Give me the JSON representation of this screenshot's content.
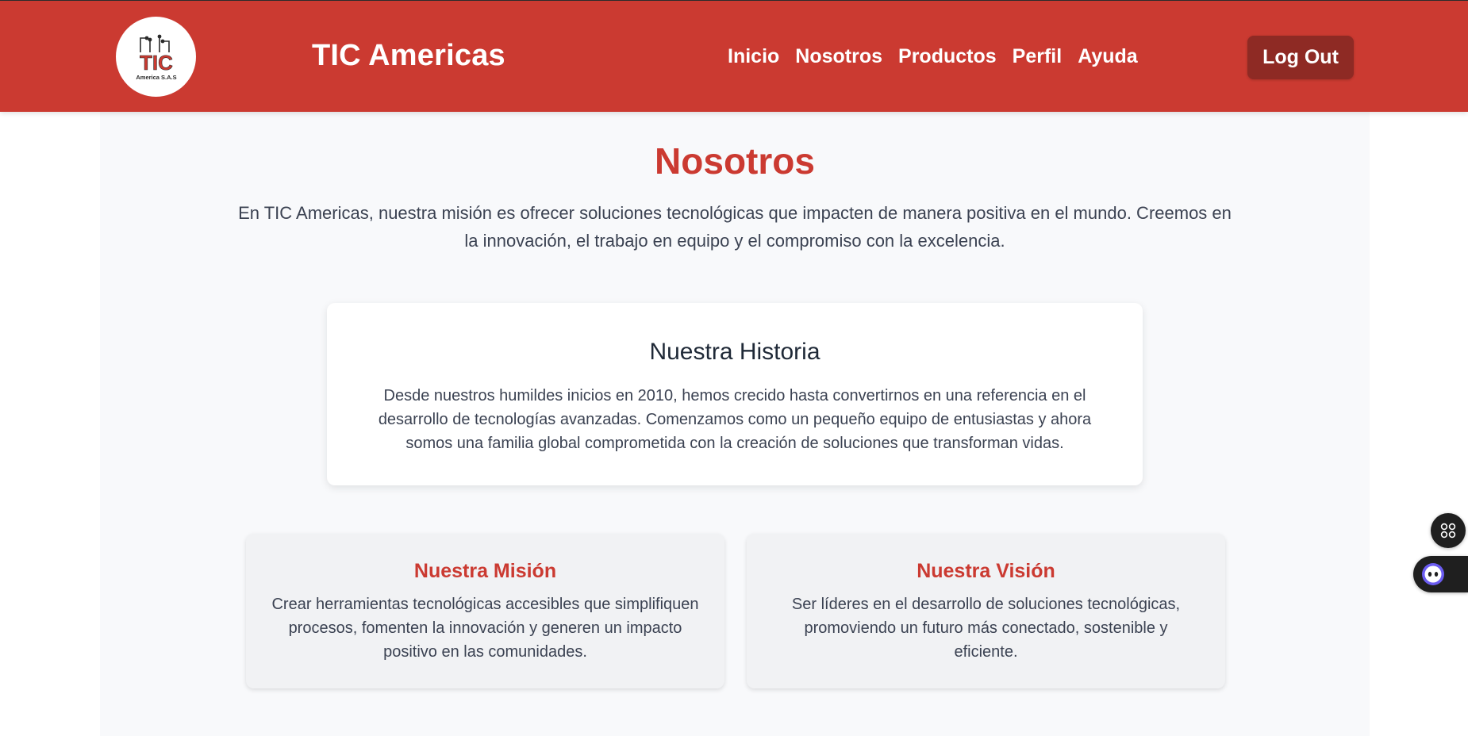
{
  "header": {
    "logo_text": "TIC",
    "logo_subtext": "America S.A.S",
    "brand": "TIC Americas",
    "nav": [
      {
        "label": "Inicio"
      },
      {
        "label": "Nosotros"
      },
      {
        "label": "Productos"
      },
      {
        "label": "Perfil"
      },
      {
        "label": "Ayuda"
      }
    ],
    "logout_label": "Log Out"
  },
  "main": {
    "title": "Nosotros",
    "intro": "En TIC Americas, nuestra misión es ofrecer soluciones tecnológicas que impacten de manera positiva en el mundo. Creemos en la innovación, el trabajo en equipo y el compromiso con la excelencia.",
    "history": {
      "title": "Nuestra Historia",
      "text": "Desde nuestros humildes inicios en 2010, hemos crecido hasta convertirnos en una referencia en el desarrollo de tecnologías avanzadas. Comenzamos como un pequeño equipo de entusiastas y ahora somos una familia global comprometida con la creación de soluciones que transforman vidas."
    },
    "mision": {
      "title": "Nuestra Misión",
      "text": "Crear herramientas tecnológicas accesibles que simplifiquen procesos, fomenten la innovación y generen un impacto positivo en las comunidades."
    },
    "vision": {
      "title": "Nuestra Visión",
      "text": "Ser líderes en el desarrollo de soluciones tecnológicas, promoviendo un futuro más conectado, sostenible y eficiente."
    }
  },
  "floating": {
    "grid_icon": "grid-icon",
    "bot_icon": "bot-face-icon"
  },
  "colors": {
    "brand_red": "#cb3a31",
    "logout_bg": "#8e2a24",
    "page_bg": "#f8f9fb",
    "text_dark": "#3b4252"
  }
}
